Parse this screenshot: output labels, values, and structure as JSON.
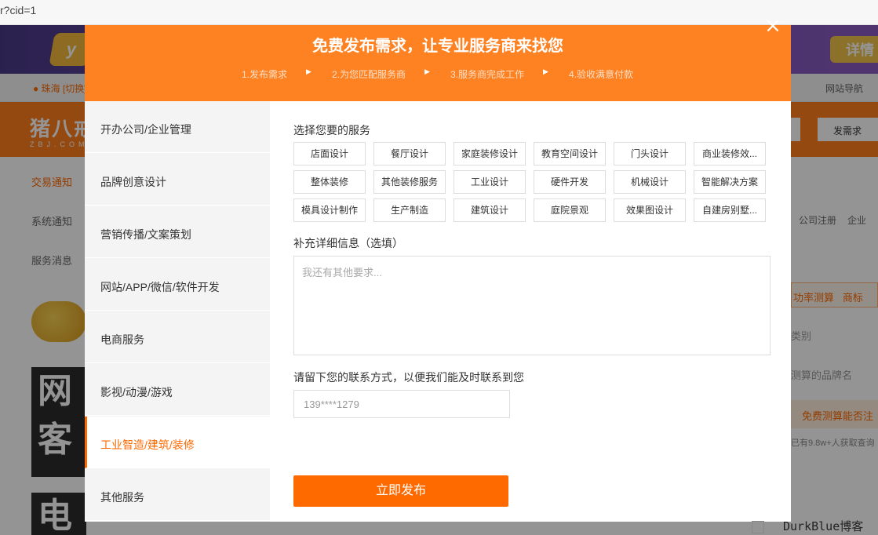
{
  "browser": {
    "url_fragment": "r?cid=1"
  },
  "background": {
    "logo_bubble": "y",
    "detail_button": "详情",
    "city": "珠海",
    "city_switch": "[切换]",
    "site_nav": "网站导航",
    "logo_text": "猪八戒",
    "logo_sub": "ZBJ.COM",
    "publish_button": "发需求",
    "left_menu": [
      "交易通知",
      "系统通知",
      "服务消息"
    ],
    "big_text_1": "网\n客",
    "big_text_2": "电",
    "right_register": [
      "公司注册",
      "企业"
    ],
    "right_calc_tab": "功率测算",
    "right_calc_tab2": "商标",
    "right_field1": "类别",
    "right_field2": "测算的品牌名",
    "right_free_btn": "免费测算能否注",
    "right_count": "已有9.8w+人获取查询"
  },
  "modal": {
    "title": "免费发布需求，让专业服务商来找您",
    "steps": [
      "1.发布需求",
      "2.为您匹配服务商",
      "3.服务商完成工作",
      "4.验收满意付款"
    ],
    "step_arrow": "▶",
    "close_icon": "×",
    "categories": [
      {
        "label": "开办公司/企业管理",
        "active": false
      },
      {
        "label": "品牌创意设计",
        "active": false
      },
      {
        "label": "营销传播/文案策划",
        "active": false
      },
      {
        "label": "网站/APP/微信/软件开发",
        "active": false
      },
      {
        "label": "电商服务",
        "active": false
      },
      {
        "label": "影视/动漫/游戏",
        "active": false
      },
      {
        "label": "工业智造/建筑/装修",
        "active": true
      },
      {
        "label": "其他服务",
        "active": false
      }
    ],
    "service_label": "选择您要的服务",
    "services": [
      "店面设计",
      "餐厅设计",
      "家庭装修设计",
      "教育空间设计",
      "门头设计",
      "商业装修效...",
      "整体装修",
      "其他装修服务",
      "工业设计",
      "硬件开发",
      "机械设计",
      "智能解决方案",
      "模具设计制作",
      "生产制造",
      "建筑设计",
      "庭院景观",
      "效果图设计",
      "自建房别墅..."
    ],
    "detail_label": "补充详细信息（选填）",
    "detail_placeholder": "我还有其他要求...",
    "contact_label": "请留下您的联系方式，以便我们能及时联系到您",
    "contact_value": "139****1279",
    "submit_label": "立即发布",
    "accent_color": "#ff6a00",
    "header_color": "#fe8122"
  },
  "watermark": "DurkBlue博客"
}
